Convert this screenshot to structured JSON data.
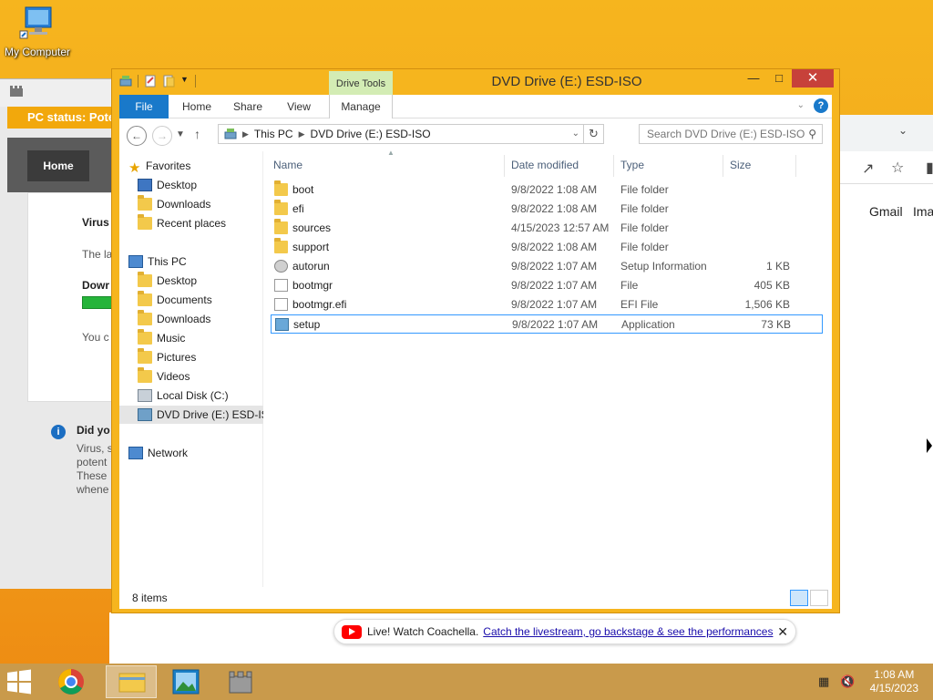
{
  "desktop": {
    "icon_label": "My Computer"
  },
  "bg_app": {
    "status": "PC status: Pote",
    "home_tab": "Home",
    "heading": "Virus",
    "line1": "The la",
    "download": "Dowr",
    "line2": "You c",
    "did_you": "Did yo",
    "para": [
      "Virus, s",
      "potent",
      "These",
      "whene"
    ]
  },
  "browser": {
    "link1": "Gmail",
    "link2": "Ima"
  },
  "youtube_banner": {
    "text": "Live! Watch Coachella.",
    "link": "Catch the livestream, go backstage & see the performances",
    "close": "✕"
  },
  "explorer": {
    "title": "DVD Drive (E:) ESD-ISO",
    "contextual_tab": "Drive Tools",
    "tabs": [
      "File",
      "Home",
      "Share",
      "View",
      "Manage"
    ],
    "address": [
      "This PC",
      "DVD Drive (E:) ESD-ISO"
    ],
    "search_placeholder": "Search DVD Drive (E:) ESD-ISO",
    "nav": {
      "favorites": "Favorites",
      "fav_items": [
        "Desktop",
        "Downloads",
        "Recent places"
      ],
      "this_pc": "This PC",
      "pc_items": [
        "Desktop",
        "Documents",
        "Downloads",
        "Music",
        "Pictures",
        "Videos",
        "Local Disk (C:)",
        "DVD Drive (E:) ESD-IS"
      ],
      "network": "Network"
    },
    "columns": [
      "Name",
      "Date modified",
      "Type",
      "Size"
    ],
    "files": [
      {
        "name": "boot",
        "date": "9/8/2022 1:08 AM",
        "type": "File folder",
        "size": "",
        "icon": "folder-icon"
      },
      {
        "name": "efi",
        "date": "9/8/2022 1:08 AM",
        "type": "File folder",
        "size": "",
        "icon": "folder-icon"
      },
      {
        "name": "sources",
        "date": "4/15/2023 12:57 AM",
        "type": "File folder",
        "size": "",
        "icon": "folder-icon"
      },
      {
        "name": "support",
        "date": "9/8/2022 1:08 AM",
        "type": "File folder",
        "size": "",
        "icon": "folder-icon"
      },
      {
        "name": "autorun",
        "date": "9/8/2022 1:07 AM",
        "type": "Setup Information",
        "size": "1 KB",
        "icon": "gear-icon"
      },
      {
        "name": "bootmgr",
        "date": "9/8/2022 1:07 AM",
        "type": "File",
        "size": "405 KB",
        "icon": "file-icon"
      },
      {
        "name": "bootmgr.efi",
        "date": "9/8/2022 1:07 AM",
        "type": "EFI File",
        "size": "1,506 KB",
        "icon": "file-icon"
      },
      {
        "name": "setup",
        "date": "9/8/2022 1:07 AM",
        "type": "Application",
        "size": "73 KB",
        "icon": "setup-icon"
      }
    ],
    "status": "8 items"
  },
  "taskbar": {
    "time": "1:08 AM",
    "date": "4/15/2023"
  }
}
